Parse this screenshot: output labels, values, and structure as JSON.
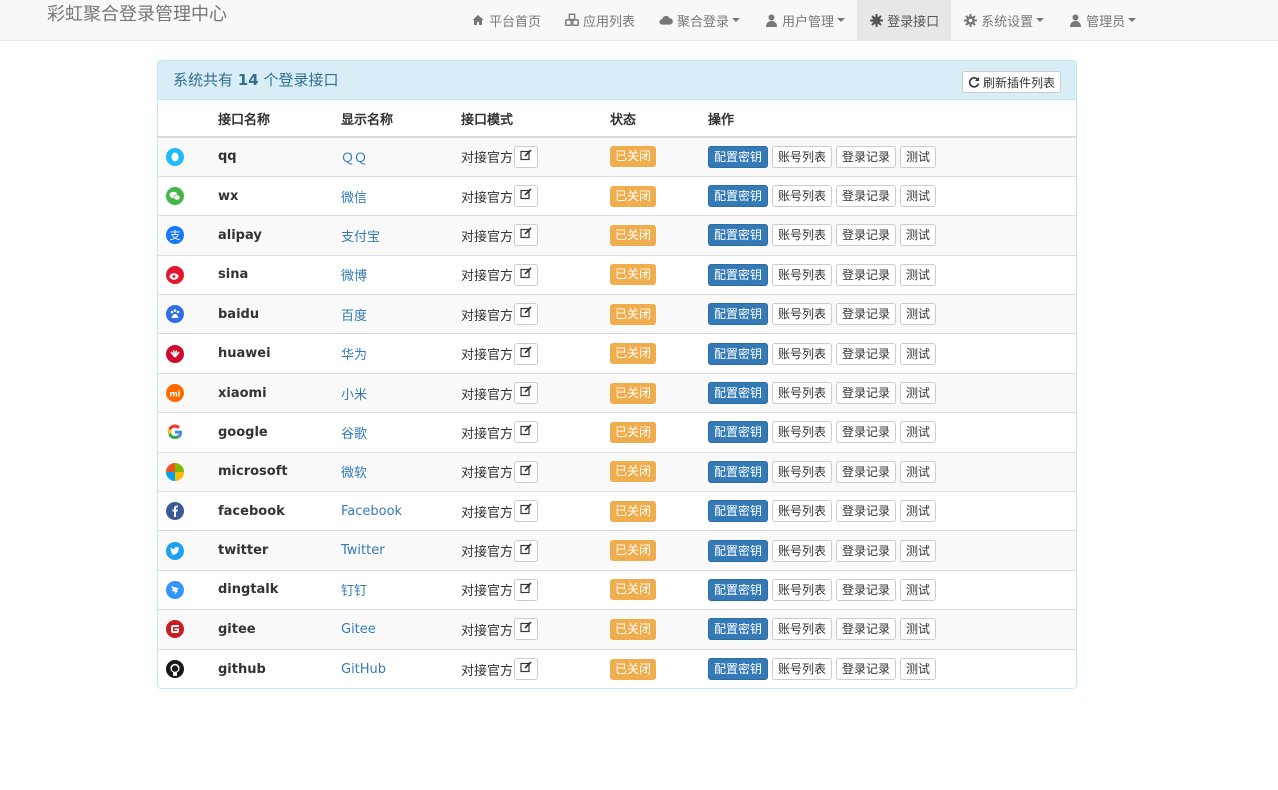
{
  "app": {
    "brand": "彩虹聚合登录管理中心"
  },
  "nav": [
    {
      "label": "平台首页",
      "icon": "home-icon",
      "dropdown": false,
      "active": false
    },
    {
      "label": "应用列表",
      "icon": "cubes-icon",
      "dropdown": false,
      "active": false
    },
    {
      "label": "聚合登录",
      "icon": "cloud-icon",
      "dropdown": true,
      "active": false
    },
    {
      "label": "用户管理",
      "icon": "user-icon",
      "dropdown": true,
      "active": false
    },
    {
      "label": "登录接口",
      "icon": "puzzle-icon",
      "dropdown": false,
      "active": true
    },
    {
      "label": "系统设置",
      "icon": "gear-icon",
      "dropdown": true,
      "active": false
    },
    {
      "label": "管理员",
      "icon": "user-icon",
      "dropdown": true,
      "active": false
    }
  ],
  "panel": {
    "title_prefix": "系统共有",
    "count": "14",
    "title_suffix": "个登录接口",
    "refresh_label": "刷新插件列表"
  },
  "table": {
    "headers": [
      "",
      "接口名称",
      "显示名称",
      "接口模式",
      "状态",
      "操作"
    ],
    "rows": [
      {
        "name": "qq",
        "display": "ＱＱ",
        "mode": "对接官方",
        "status": "已关闭",
        "icon": "qq-icon",
        "color": "#1ebafc"
      },
      {
        "name": "wx",
        "display": "微信",
        "mode": "对接官方",
        "status": "已关闭",
        "icon": "wechat-icon",
        "color": "#44b549"
      },
      {
        "name": "alipay",
        "display": "支付宝",
        "mode": "对接官方",
        "status": "已关闭",
        "icon": "alipay-icon",
        "color": "#1677ff"
      },
      {
        "name": "sina",
        "display": "微博",
        "mode": "对接官方",
        "status": "已关闭",
        "icon": "weibo-icon",
        "color": "#e6162d"
      },
      {
        "name": "baidu",
        "display": "百度",
        "mode": "对接官方",
        "status": "已关闭",
        "icon": "baidu-icon",
        "color": "#2932e1"
      },
      {
        "name": "huawei",
        "display": "华为",
        "mode": "对接官方",
        "status": "已关闭",
        "icon": "huawei-icon",
        "color": "#cf0a2c"
      },
      {
        "name": "xiaomi",
        "display": "小米",
        "mode": "对接官方",
        "status": "已关闭",
        "icon": "xiaomi-icon",
        "color": "#ff6900"
      },
      {
        "name": "google",
        "display": "谷歌",
        "mode": "对接官方",
        "status": "已关闭",
        "icon": "google-icon",
        "color": "#4285f4"
      },
      {
        "name": "microsoft",
        "display": "微软",
        "mode": "对接官方",
        "status": "已关闭",
        "icon": "microsoft-icon",
        "color": "#f25022"
      },
      {
        "name": "facebook",
        "display": "Facebook",
        "mode": "对接官方",
        "status": "已关闭",
        "icon": "facebook-icon",
        "color": "#3b5998"
      },
      {
        "name": "twitter",
        "display": "Twitter",
        "mode": "对接官方",
        "status": "已关闭",
        "icon": "twitter-icon",
        "color": "#1da1f2"
      },
      {
        "name": "dingtalk",
        "display": "钉钉",
        "mode": "对接官方",
        "status": "已关闭",
        "icon": "dingtalk-icon",
        "color": "#3296fa"
      },
      {
        "name": "gitee",
        "display": "Gitee",
        "mode": "对接官方",
        "status": "已关闭",
        "icon": "gitee-icon",
        "color": "#c71d23"
      },
      {
        "name": "github",
        "display": "GitHub",
        "mode": "对接官方",
        "status": "已关闭",
        "icon": "github-icon",
        "color": "#181717"
      }
    ],
    "actions": [
      "配置密钥",
      "账号列表",
      "登录记录",
      "测试"
    ]
  }
}
